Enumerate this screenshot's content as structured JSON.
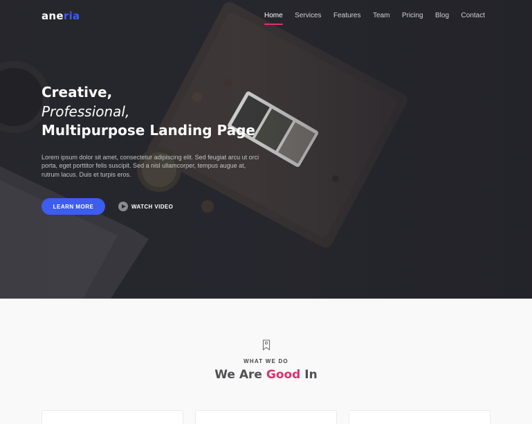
{
  "brand": {
    "logo_part1": "ane",
    "logo_part2": "ria",
    "accent_color": "#3d5cf0",
    "highlight_color": "#e0306f"
  },
  "nav": {
    "items": [
      {
        "label": "Home",
        "active": true
      },
      {
        "label": "Services",
        "active": false
      },
      {
        "label": "Features",
        "active": false
      },
      {
        "label": "Team",
        "active": false
      },
      {
        "label": "Pricing",
        "active": false
      },
      {
        "label": "Blog",
        "active": false
      },
      {
        "label": "Contact",
        "active": false
      }
    ]
  },
  "hero": {
    "line1": "Creative,",
    "line2": "Professional,",
    "line3": "Multipurpose Landing Page",
    "paragraph": "Lorem ipsum dolor sit amet, consectetur adipiscing elit. Sed feugiat arcu ut orci porta, eget porttitor felis suscipit. Sed a nisl ullamcorper, tempus augue at, rutrum lacus. Duis et turpis eros.",
    "primary_button": "LEARN MORE",
    "video_button": "WATCH VIDEO",
    "video_icon": "play-icon"
  },
  "section": {
    "icon": "bookmark-icon",
    "eyebrow": "WHAT WE DO",
    "title_part1": "We Are ",
    "title_highlight": "Good",
    "title_part2": " In"
  }
}
